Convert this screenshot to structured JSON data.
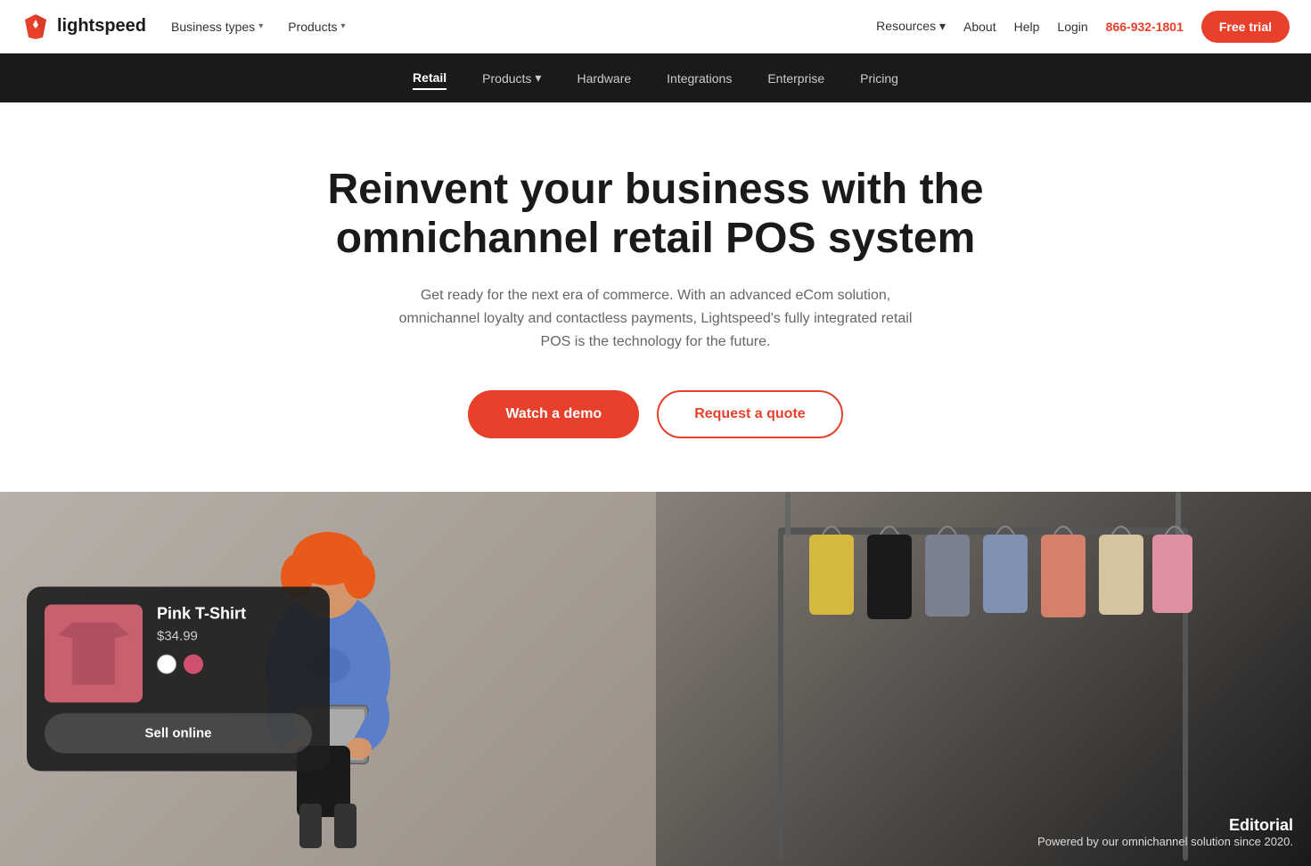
{
  "logo": {
    "text": "lightspeed"
  },
  "topnav": {
    "left": [
      {
        "label": "Business types",
        "has_dropdown": true
      },
      {
        "label": "Products",
        "has_dropdown": true
      }
    ],
    "right": [
      {
        "label": "Resources",
        "has_dropdown": true
      },
      {
        "label": "About",
        "has_dropdown": false
      },
      {
        "label": "Help",
        "has_dropdown": false
      },
      {
        "label": "Login",
        "has_dropdown": false
      }
    ],
    "phone": "866-932-1801",
    "free_trial": "Free trial"
  },
  "subnav": {
    "items": [
      {
        "label": "Retail",
        "active": true
      },
      {
        "label": "Products",
        "has_dropdown": true
      },
      {
        "label": "Hardware",
        "has_dropdown": false
      },
      {
        "label": "Integrations",
        "has_dropdown": false
      },
      {
        "label": "Enterprise",
        "has_dropdown": false
      },
      {
        "label": "Pricing",
        "has_dropdown": false
      }
    ]
  },
  "hero": {
    "title": "Reinvent your business with the omnichannel retail POS system",
    "subtitle": "Get ready for the next era of commerce. With an advanced eCom solution, omnichannel loyalty and contactless payments, Lightspeed's fully integrated retail POS is the technology for the future.",
    "btn_primary": "Watch a demo",
    "btn_secondary": "Request a quote"
  },
  "product_card": {
    "name": "Pink T-Shirt",
    "price": "$34.99",
    "sell_label": "Sell online"
  },
  "editorial": {
    "title": "Editorial",
    "subtitle": "Powered by our omnichannel solution since 2020."
  }
}
